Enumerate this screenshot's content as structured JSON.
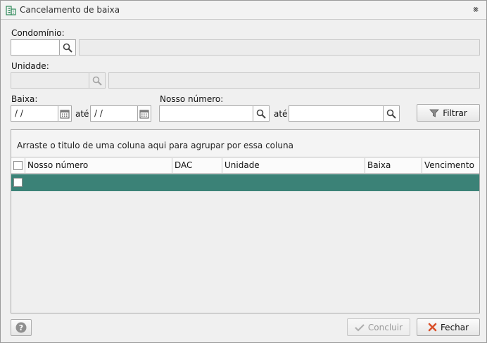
{
  "window": {
    "title": "Cancelamento de baixa",
    "close_glyph": "⨳"
  },
  "form": {
    "condominio_label": "Condomínio:",
    "condominio_value": "",
    "condominio_name": "",
    "unidade_label": "Unidade:",
    "unidade_value": "",
    "unidade_name": "",
    "baixa_label": "Baixa:",
    "baixa_from": "/ /",
    "baixa_to": "/ /",
    "ate_label": "até",
    "nosso_numero_label": "Nosso número:",
    "nosso_numero_from": "",
    "nosso_numero_to": "",
    "ate_label_2": "até",
    "filter_button": "Filtrar"
  },
  "grid": {
    "group_hint": "Arraste o titulo de uma coluna aqui para agrupar por essa coluna",
    "columns": [
      "Nosso número",
      "DAC",
      "Unidade",
      "Baixa",
      "Vencimento"
    ],
    "selected_row_color": "#3b8277"
  },
  "footer": {
    "concluir_button": "Concluir",
    "fechar_button": "Fechar"
  },
  "icons": [
    "building-icon",
    "close-icon",
    "search-icon",
    "calendar-icon",
    "funnel-icon",
    "checkmark-icon",
    "x-icon",
    "help-icon"
  ]
}
